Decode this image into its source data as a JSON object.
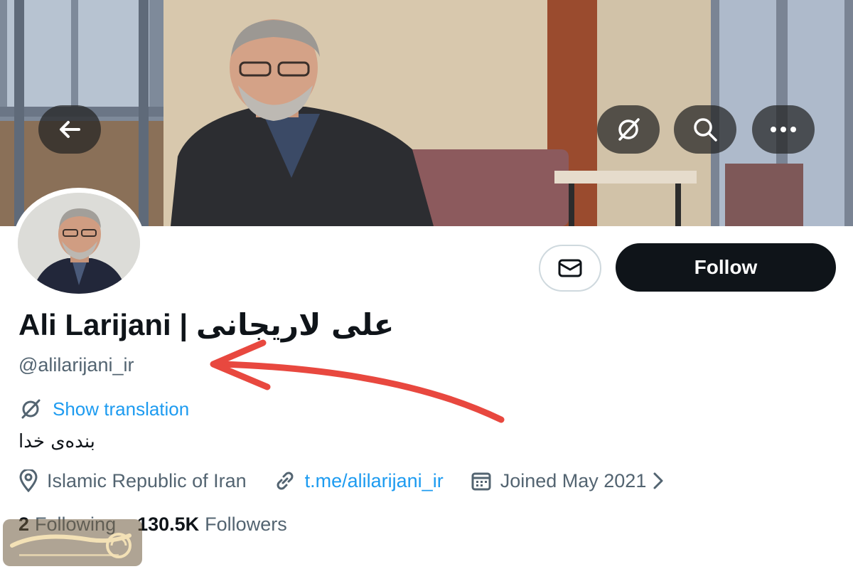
{
  "banner": {
    "back_icon": "arrow-left-icon",
    "translate_icon": "translate-slash-icon",
    "search_icon": "search-icon",
    "more_icon": "more-horizontal-icon"
  },
  "actions": {
    "message_icon": "mail-icon",
    "follow_label": "Follow"
  },
  "profile": {
    "name_latin": "Ali Larijani |",
    "name_persian": "علی لاریجانی",
    "handle": "@alilarijani_ir",
    "show_translation": "Show translation",
    "bio": "بنده‌ی خدا",
    "location": "Islamic Republic of Iran",
    "link": "t.me/alilarijani_ir",
    "joined": "Joined May 2021"
  },
  "stats": {
    "following_count": "2",
    "following_label": "Following",
    "followers_count": "130.5K",
    "followers_label": "Followers"
  },
  "colors": {
    "accent": "#1d9bf0",
    "text": "#0f1419",
    "muted": "#536471",
    "arrow_annotation": "#e8483f"
  }
}
